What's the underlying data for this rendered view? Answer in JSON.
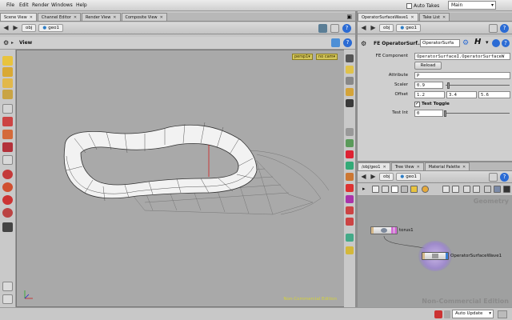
{
  "menubar": {
    "items": [
      "File",
      "Edit",
      "Render",
      "Windows",
      "Help"
    ],
    "auto_takes_label": "Auto Takes",
    "desktop": "Main"
  },
  "left_tabs": [
    "Scene View",
    "Channel Editor",
    "Render View",
    "Composite View"
  ],
  "left_path": {
    "root": "obj",
    "node": "geo1"
  },
  "view": {
    "label": "View",
    "camera": "persp1▾",
    "cam_dropdown": "no cam▾",
    "watermark": "Non-Commercial Edition"
  },
  "right_tabs": [
    "OperatorSurfaceWave1",
    "Take List"
  ],
  "right_path": {
    "root": "obj",
    "node": "geo1"
  },
  "parm": {
    "node_type": "FE OperatorSurf...",
    "node_name": "OperatorSurfa",
    "rows": {
      "fe_component": {
        "label": "FE Component",
        "value": "OperatorSurfaceI.OperatorSurfaceW"
      },
      "reload": {
        "label": "Reload"
      },
      "attribute": {
        "label": "Attribute",
        "value": "P"
      },
      "scaler": {
        "label": "Scaler",
        "value": "0.9"
      },
      "offset": {
        "label": "Offset",
        "x": "1.2",
        "y": "3.4",
        "z": "5.6"
      },
      "test_toggle": {
        "label": "Test Toggle",
        "checked": true
      },
      "test_int": {
        "label": "Test Int",
        "value": "0"
      }
    }
  },
  "net_tabs": [
    "/obj/geo1",
    "Tree View",
    "Material Palette"
  ],
  "net_path": {
    "root": "obj",
    "node": "geo1"
  },
  "network": {
    "context": "Geometry",
    "watermark": "Non-Commercial Edition",
    "nodes": [
      {
        "name": "torus1"
      },
      {
        "name": "OperatorSurfaceWave1"
      }
    ]
  },
  "status": {
    "update_mode": "Auto Update"
  },
  "colors": {
    "accent_yellow": "#d2c55a",
    "node_purple": "#6f6fb0",
    "viewport_bg": "#a9a9a9"
  }
}
